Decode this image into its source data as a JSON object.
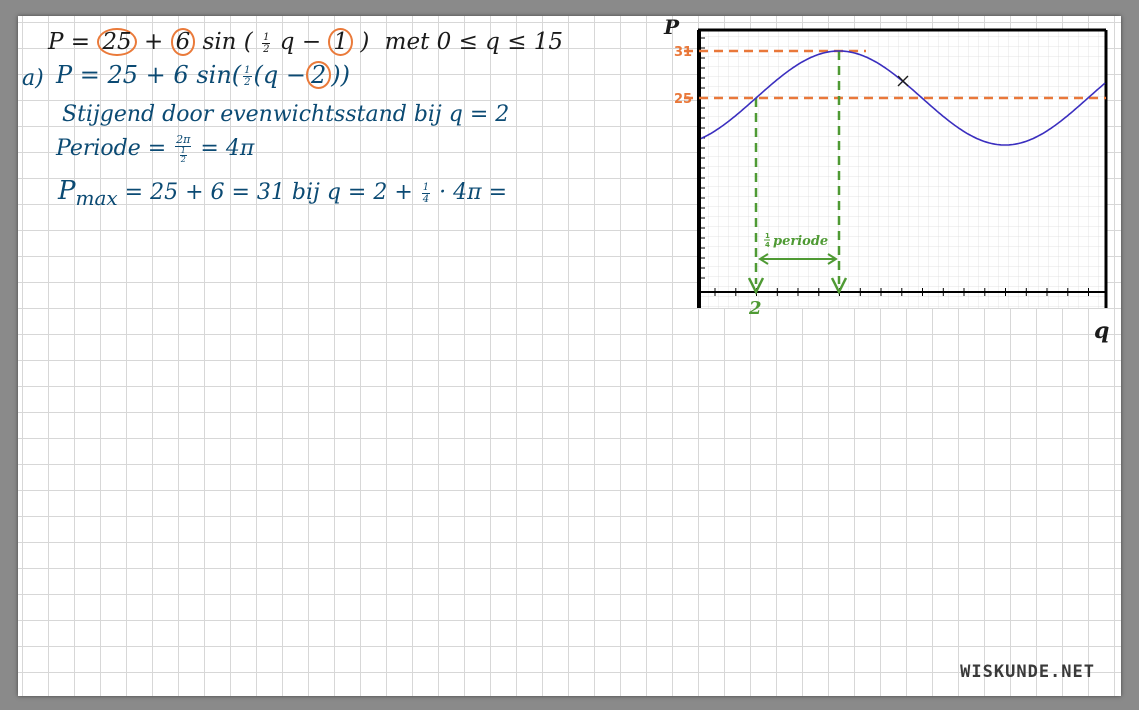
{
  "formula": {
    "left": "P =",
    "c1": "25",
    "plus1": "+",
    "c2": "6",
    "sin_open": "sin (",
    "frac_num": "1",
    "frac_den": "2",
    "var": "q −",
    "c3": "1",
    "close": ")",
    "domain": "met  0 ≤ q ≤ 15"
  },
  "part_a": {
    "label": "a)",
    "eq_left": "P = 25 + 6 sin(",
    "frac_num": "1",
    "frac_den": "2",
    "eq_mid": "(q −",
    "shift": "2",
    "eq_right": "))",
    "line2": "Stijgend door evenwichtsstand bij  q = 2",
    "line3_left": "Periode =",
    "line3_num": "2π",
    "line3_den_num": "1",
    "line3_den_den": "2",
    "line3_right": "= 4π",
    "line4_p": "P",
    "line4_sub": "max",
    "line4_mid": "= 25 + 6 = 31  bij  q = 2 +",
    "line4_fnum": "1",
    "line4_fden": "4",
    "line4_end": "· 4π ="
  },
  "graph": {
    "y_axis_label": "P",
    "x_axis_label": "q",
    "y_tick_31": "31",
    "y_tick_25": "25",
    "x_tick_2": "2",
    "annotation_num": "1",
    "annotation_den": "4",
    "annotation_text": "periode",
    "colors": {
      "curve": "#3b2fbf",
      "guide_orange": "#e9783a",
      "guide_green": "#4f9a34",
      "axis": "#000000"
    },
    "grid": true
  },
  "watermark": "WISKUNDE.NET"
}
